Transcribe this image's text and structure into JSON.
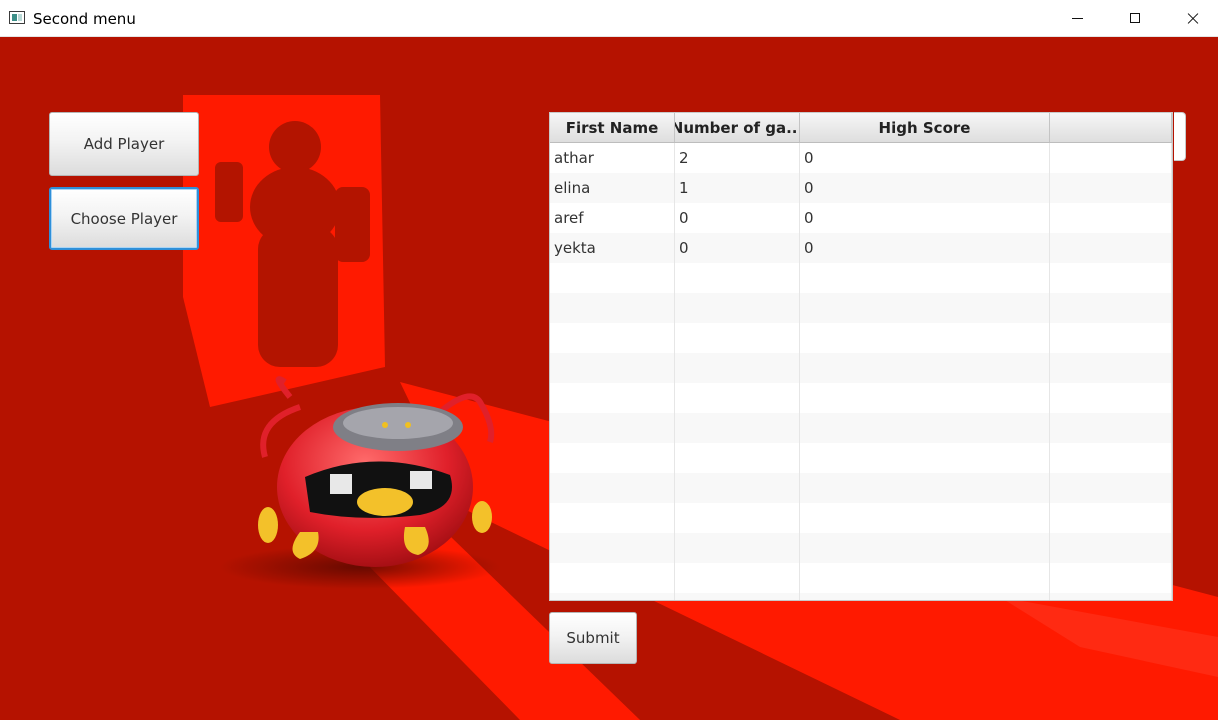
{
  "window": {
    "title": "Second menu",
    "controls": [
      "minimize-icon",
      "maximize-icon",
      "close-icon"
    ]
  },
  "buttons": {
    "add_player": "Add Player",
    "choose_player": "Choose Player",
    "submit": "Submit"
  },
  "table": {
    "columns": [
      "First Name",
      "Number of ga...",
      "High Score",
      ""
    ],
    "rows": [
      [
        "athar",
        "2",
        "0",
        ""
      ],
      [
        "elina",
        "1",
        "0",
        ""
      ],
      [
        "aref",
        "0",
        "0",
        ""
      ],
      [
        "yekta",
        "0",
        "0",
        ""
      ],
      [
        "",
        "",
        "",
        ""
      ],
      [
        "",
        "",
        "",
        ""
      ],
      [
        "",
        "",
        "",
        ""
      ],
      [
        "",
        "",
        "",
        ""
      ],
      [
        "",
        "",
        "",
        ""
      ],
      [
        "",
        "",
        "",
        ""
      ],
      [
        "",
        "",
        "",
        ""
      ],
      [
        "",
        "",
        "",
        ""
      ],
      [
        "",
        "",
        "",
        ""
      ],
      [
        "",
        "",
        "",
        ""
      ],
      [
        "",
        "",
        "",
        ""
      ],
      [
        "",
        "",
        "",
        ""
      ]
    ]
  },
  "colors": {
    "background": "#b51200",
    "light_beam": "#ff1a00",
    "focus_border": "#2f8fd8"
  }
}
